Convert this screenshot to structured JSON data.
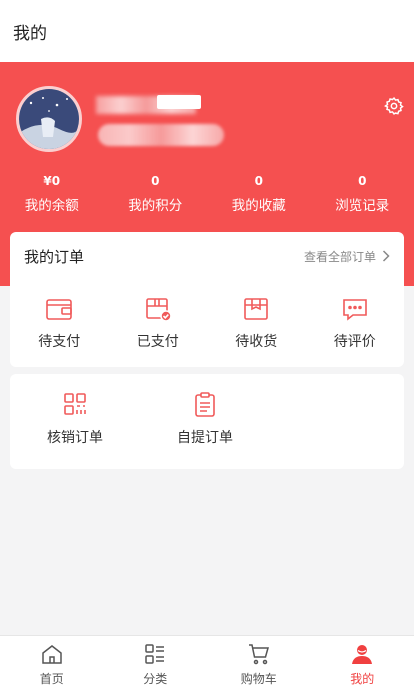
{
  "page_title": "我的",
  "stats": [
    {
      "value": "¥0",
      "label": "我的余额"
    },
    {
      "value": "0",
      "label": "我的积分"
    },
    {
      "value": "0",
      "label": "我的收藏"
    },
    {
      "value": "0",
      "label": "浏览记录"
    }
  ],
  "orders": {
    "title": "我的订单",
    "view_all": "查看全部订单",
    "items": [
      {
        "label": "待支付",
        "icon": "wallet-icon"
      },
      {
        "label": "已支付",
        "icon": "paid-box-icon"
      },
      {
        "label": "待收货",
        "icon": "package-icon"
      },
      {
        "label": "待评价",
        "icon": "comment-icon"
      }
    ]
  },
  "extra": {
    "items": [
      {
        "label": "核销订单",
        "icon": "qr-code-icon"
      },
      {
        "label": "自提订单",
        "icon": "clipboard-icon"
      }
    ]
  },
  "tabs": [
    {
      "label": "首页",
      "icon": "home-icon"
    },
    {
      "label": "分类",
      "icon": "category-icon"
    },
    {
      "label": "购物车",
      "icon": "cart-icon"
    },
    {
      "label": "我的",
      "icon": "user-icon",
      "active": true
    }
  ],
  "colors": {
    "accent": "#f55050",
    "active_tab": "#f04040"
  }
}
